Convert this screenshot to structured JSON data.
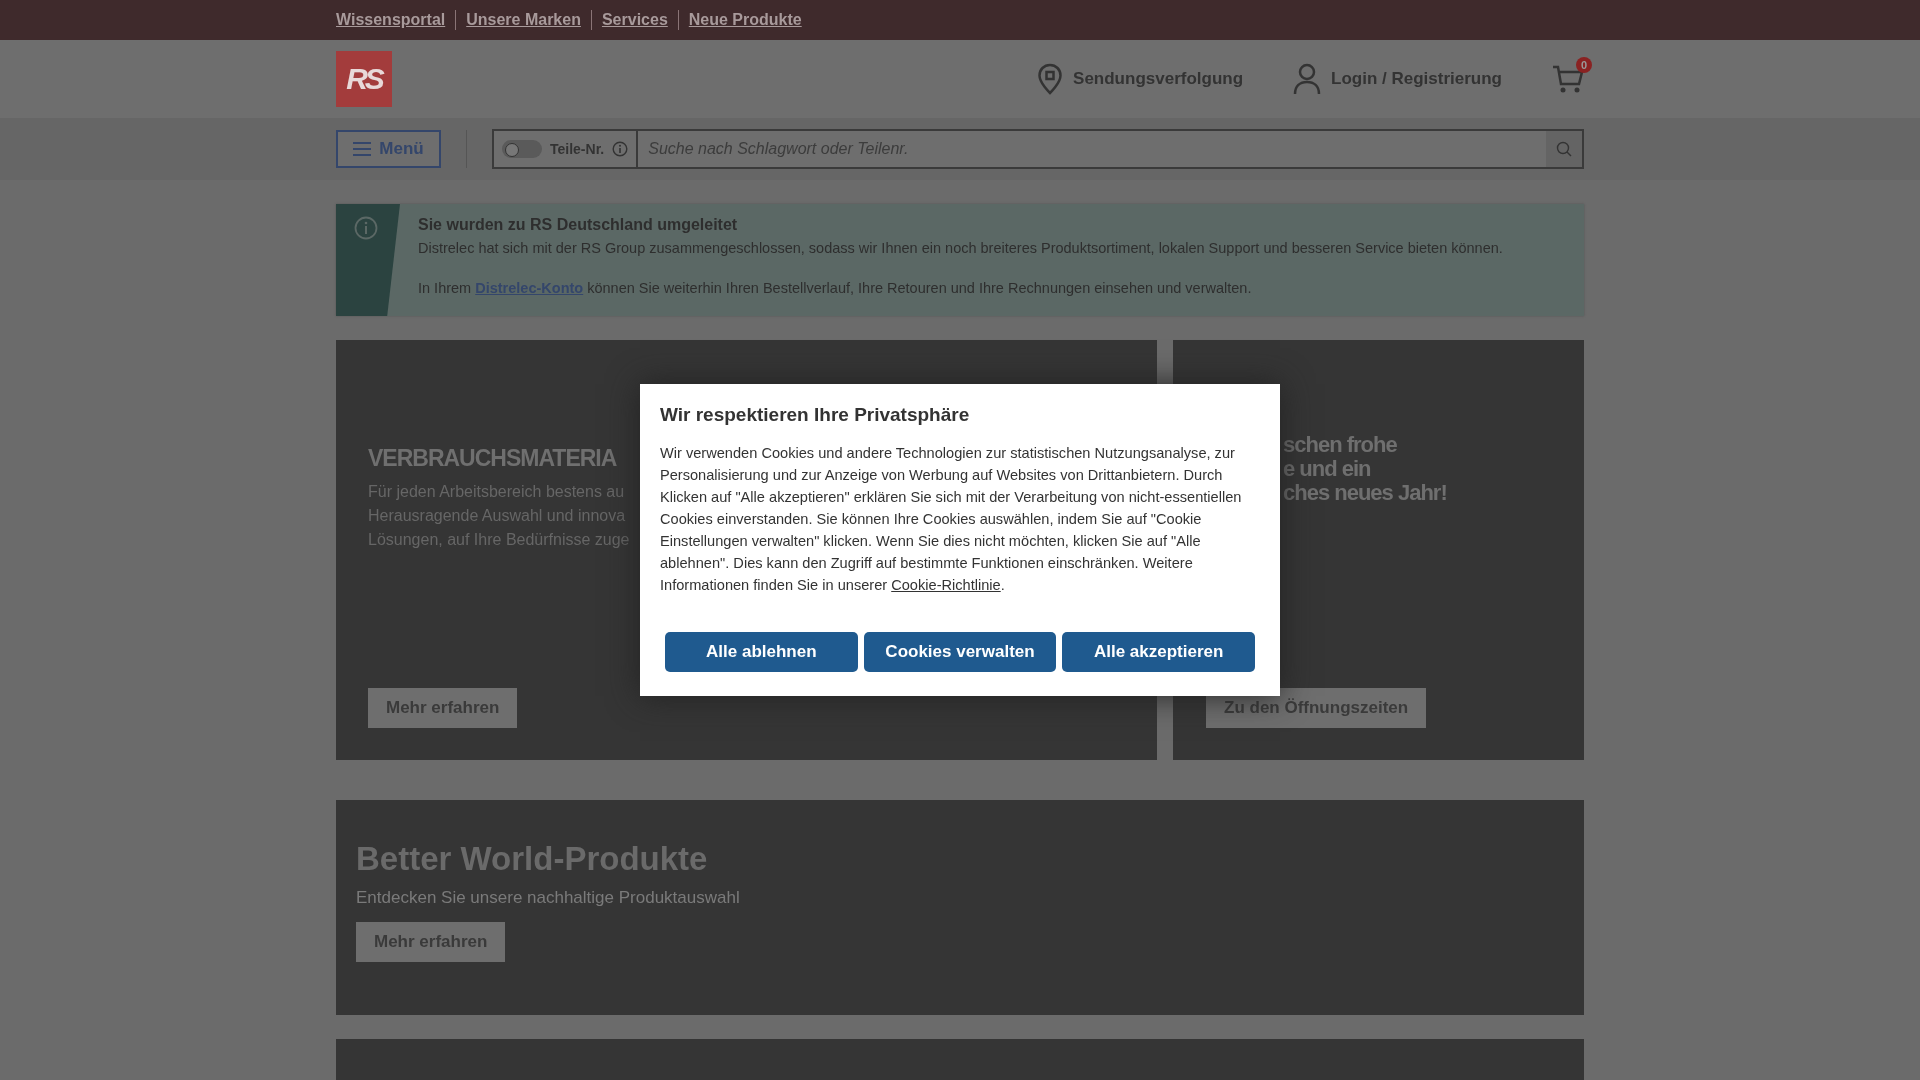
{
  "top_links": [
    "Wissensportal",
    "Unsere Marken",
    "Services",
    "Neue Produkte"
  ],
  "header": {
    "logo": "RS",
    "tracking": "Sendungsverfolgung",
    "login": "Login / Registrierung",
    "cart_count": "0"
  },
  "search_bar": {
    "menu": "Menü",
    "part_toggle": {
      "label": "Teile-Nr.",
      "on": false
    },
    "placeholder": "Suche nach Schlagwort oder Teilenr."
  },
  "notice": {
    "title": "Sie wurden zu RS Deutschland umgeleitet",
    "text": "Distrelec hat sich mit der RS Group zusammengeschlossen, sodass wir Ihnen ein noch breiteres Produktsortiment, lokalen Support und besseren Service bieten können.",
    "account_before": "In Ihrem",
    "account_link": "Distrelec-Konto",
    "account_after": "können Sie weiterhin Ihren Bestellverlauf, Ihre Retouren und Ihre Rechnungen einsehen und verwalten."
  },
  "promos": [
    {
      "heading_lines": [
        "VERBRAUCHSMATERIA"
      ],
      "text_lines": [
        "Für jeden Arbeitsbereich bestens au",
        "Herausragende Auswahl und innova",
        "Lösungen, auf Ihre Bedürfnisse zuge"
      ],
      "button": "Mehr erfahren"
    },
    {
      "heading_lines": [
        "schen frohe",
        "e und ein",
        "ches neues Jahr!"
      ],
      "button": "Zu den Öffnungszeiten"
    }
  ],
  "feature": {
    "title": "Better World-Produkte",
    "text": "Entdecken Sie unsere nachhaltige Produktauswahl",
    "button": "Mehr erfahren"
  },
  "cookie_dialog": {
    "title": "Wir respektieren Ihre Privatsphäre",
    "text": "Wir verwenden Cookies und andere Technologien zur statistischen Nutzungsanalyse, zur Personalisierung und zur Anzeige von Werbung auf Websites von Drittanbietern. Durch Klicken auf \"Alle akzeptieren\" erklären Sie sich mit der Verarbeitung von nicht-essentiellen Cookies einverstanden. Sie können Ihre Cookies auswählen, indem Sie auf \"Cookie Einstellungen verwalten\" klicken. Wenn Sie dies nicht möchten, klicken Sie auf \"Alle ablehnen\". Dies kann den Zugriff auf bestimmte Funktionen einschränken. Weitere Informationen finden Sie in unserer",
    "link": "Cookie-Richtlinie",
    "after_link": ".",
    "buttons": [
      "Alle ablehnen",
      "Cookies verwalten",
      "Alle akzeptieren"
    ]
  }
}
